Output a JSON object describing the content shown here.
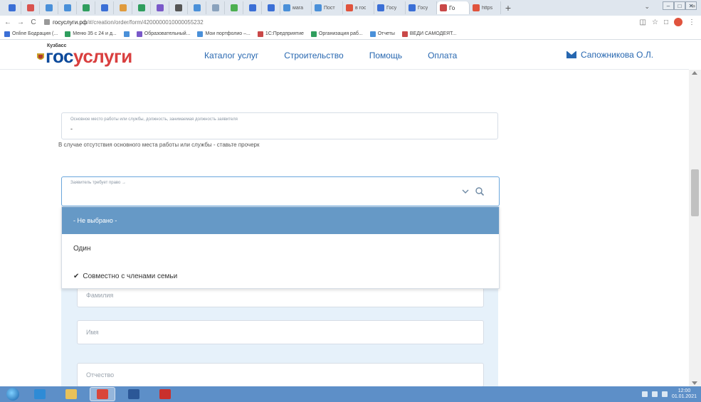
{
  "browser": {
    "tabs": [
      {
        "color": "#3b6fd6",
        "label": ""
      },
      {
        "color": "#d9534f",
        "label": ""
      },
      {
        "color": "#4a90d9",
        "label": ""
      },
      {
        "color": "#4a90d9",
        "label": ""
      },
      {
        "color": "#2f9e5e",
        "label": ""
      },
      {
        "color": "#3b6fd6",
        "label": ""
      },
      {
        "color": "#e09b3d",
        "label": ""
      },
      {
        "color": "#2f9e5e",
        "label": ""
      },
      {
        "color": "#7a59c9",
        "label": ""
      },
      {
        "color": "#555555",
        "label": ""
      },
      {
        "color": "#4a90d9",
        "label": ""
      },
      {
        "color": "#8aa2bd",
        "label": ""
      },
      {
        "color": "#4caf50",
        "label": ""
      },
      {
        "color": "#3b6fd6",
        "label": ""
      },
      {
        "color": "#3b6fd6",
        "label": ""
      },
      {
        "color": "#4a90d9",
        "label": "мага"
      },
      {
        "color": "#4a90d9",
        "label": "Пост"
      },
      {
        "color": "#e0533d",
        "label": "в гос"
      },
      {
        "color": "#3b6fd6",
        "label": "Госу"
      },
      {
        "color": "#3b6fd6",
        "label": "Госу"
      },
      {
        "color": "#c94848",
        "label": "Го",
        "active": true
      },
      {
        "color": "#e0533d",
        "label": "https"
      }
    ],
    "new_tab": "+",
    "tab_menu": "⌄",
    "window_controls": [
      "–",
      "□",
      "✕"
    ],
    "nav": [
      "←",
      "→",
      "C"
    ],
    "url_domain": "госуслуги.рф",
    "url_path": "/#/creation/order/form/4200000010000055232",
    "bookmarks": [
      {
        "color": "#3b6fd6",
        "label": "Online Бодрация (..."
      },
      {
        "color": "#2f9e5e",
        "label": "Меню 35 с 24 и д..."
      },
      {
        "color": "#4a90d9",
        "label": ""
      },
      {
        "color": "#7a59c9",
        "label": "Образовательный..."
      },
      {
        "color": "#4a90d9",
        "label": "Мои портфолио –..."
      },
      {
        "color": "#c94848",
        "label": "1С:Предприятие"
      },
      {
        "color": "#2f9e5e",
        "label": "Организация раб..."
      },
      {
        "color": "#4a90d9",
        "label": "Отчеты"
      },
      {
        "color": "#c94848",
        "label": "ВЕДИ САМОДЕЯТ..."
      }
    ],
    "bookmarks_more": "»"
  },
  "header": {
    "logo_small": "Кузбасс",
    "logo_part1": "гос",
    "logo_part2": "услуги",
    "nav": [
      "Каталог услуг",
      "Строительство",
      "Помощь",
      "Оплата"
    ],
    "user_name": "Сапожникова О.Л.",
    "accent": "#2767b0",
    "logo_red": "#d93f3f",
    "logo_blue": "#0d4a9b"
  },
  "form": {
    "workplace_caption": "Основное место работы или службы, должность, занимаемая должность заявителя",
    "workplace_value": "-",
    "hint": "В случае отсутствия основного места работы или службы - ставьте прочерк",
    "select_caption": "Заявитель требует право →",
    "options": [
      {
        "label": "- Не выбрано -",
        "highlighted": true,
        "checked": false
      },
      {
        "label": "Один",
        "highlighted": false,
        "checked": false
      },
      {
        "label": "Совместно с членами семьи",
        "highlighted": false,
        "checked": true
      }
    ],
    "family_fields": [
      {
        "placeholder": "Фамилия"
      },
      {
        "placeholder": "Имя"
      },
      {
        "placeholder": "Отчество"
      }
    ],
    "highlight_color": "#6699c6",
    "panel_color": "#e6f1fa"
  },
  "taskbar": {
    "apps": [
      {
        "name": "ie-icon",
        "color": "#2e8bd6"
      },
      {
        "name": "explorer-icon",
        "color": "#e8c15a"
      },
      {
        "name": "chrome-icon",
        "color": "#d9463b",
        "active": true
      },
      {
        "name": "word-icon",
        "color": "#2b5797"
      },
      {
        "name": "pdf-icon",
        "color": "#c9302c"
      }
    ],
    "clock_time": "12:00",
    "clock_date": "01.01.2021"
  }
}
